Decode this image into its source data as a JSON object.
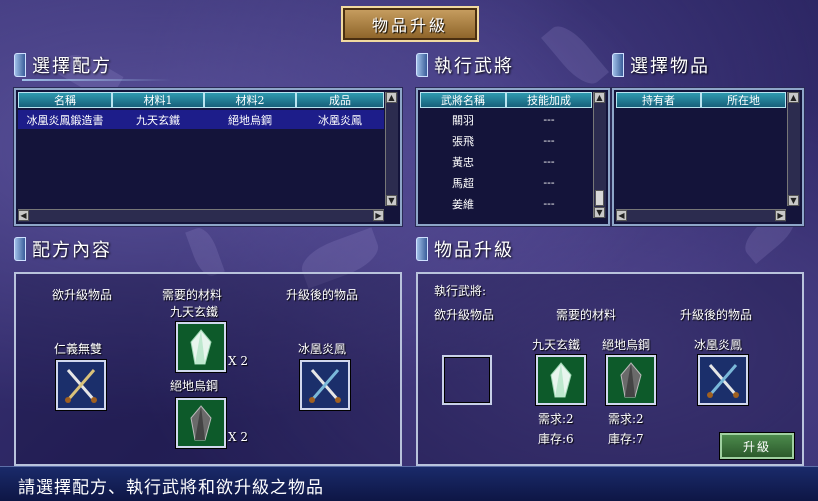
{
  "window": {
    "title": "物品升級"
  },
  "recipe_select": {
    "title": "選擇配方",
    "columns": [
      "名稱",
      "材料1",
      "材料2",
      "成品"
    ],
    "rows": [
      {
        "name": "冰凰炎鳳鍛造書",
        "mat1": "九天玄鐵",
        "mat2": "絕地烏鋼",
        "product": "冰凰炎鳳"
      }
    ]
  },
  "general_select": {
    "title": "執行武將",
    "columns": [
      "武將名稱",
      "技能加成"
    ],
    "rows": [
      {
        "name": "關羽",
        "bonus": "---"
      },
      {
        "name": "張飛",
        "bonus": "---"
      },
      {
        "name": "黃忠",
        "bonus": "---"
      },
      {
        "name": "馬超",
        "bonus": "---"
      },
      {
        "name": "姜維",
        "bonus": "---"
      }
    ]
  },
  "item_select": {
    "title": "選擇物品",
    "columns": [
      "持有者",
      "所在地"
    ]
  },
  "recipe_detail": {
    "title": "配方內容",
    "upgrade_item_label": "欲升級物品",
    "materials_label": "需要的材料",
    "result_label": "升級後的物品",
    "upgrade_item_name": "仁義無雙",
    "material1_name": "九天玄鐵",
    "material1_qty": "X 2",
    "material2_name": "絕地烏鋼",
    "material2_qty": "X 2",
    "result_name": "冰凰炎鳳"
  },
  "item_upgrade": {
    "title": "物品升級",
    "general_label": "執行武將:",
    "upgrade_item_label": "欲升級物品",
    "materials_label": "需要的材料",
    "result_label": "升級後的物品",
    "material1_name": "九天玄鐵",
    "material2_name": "絕地烏鋼",
    "result_name": "冰凰炎鳳",
    "material1_need": "需求:2",
    "material1_stock": "庫存:6",
    "material2_need": "需求:2",
    "material2_stock": "庫存:7",
    "upgrade_button": "升級"
  },
  "status_bar": {
    "text": "請選擇配方、執行武將和欲升級之物品"
  },
  "colors": {
    "accent": "#8ea6c8",
    "selected_row": "#1d1d8a",
    "header": "#17607a"
  }
}
